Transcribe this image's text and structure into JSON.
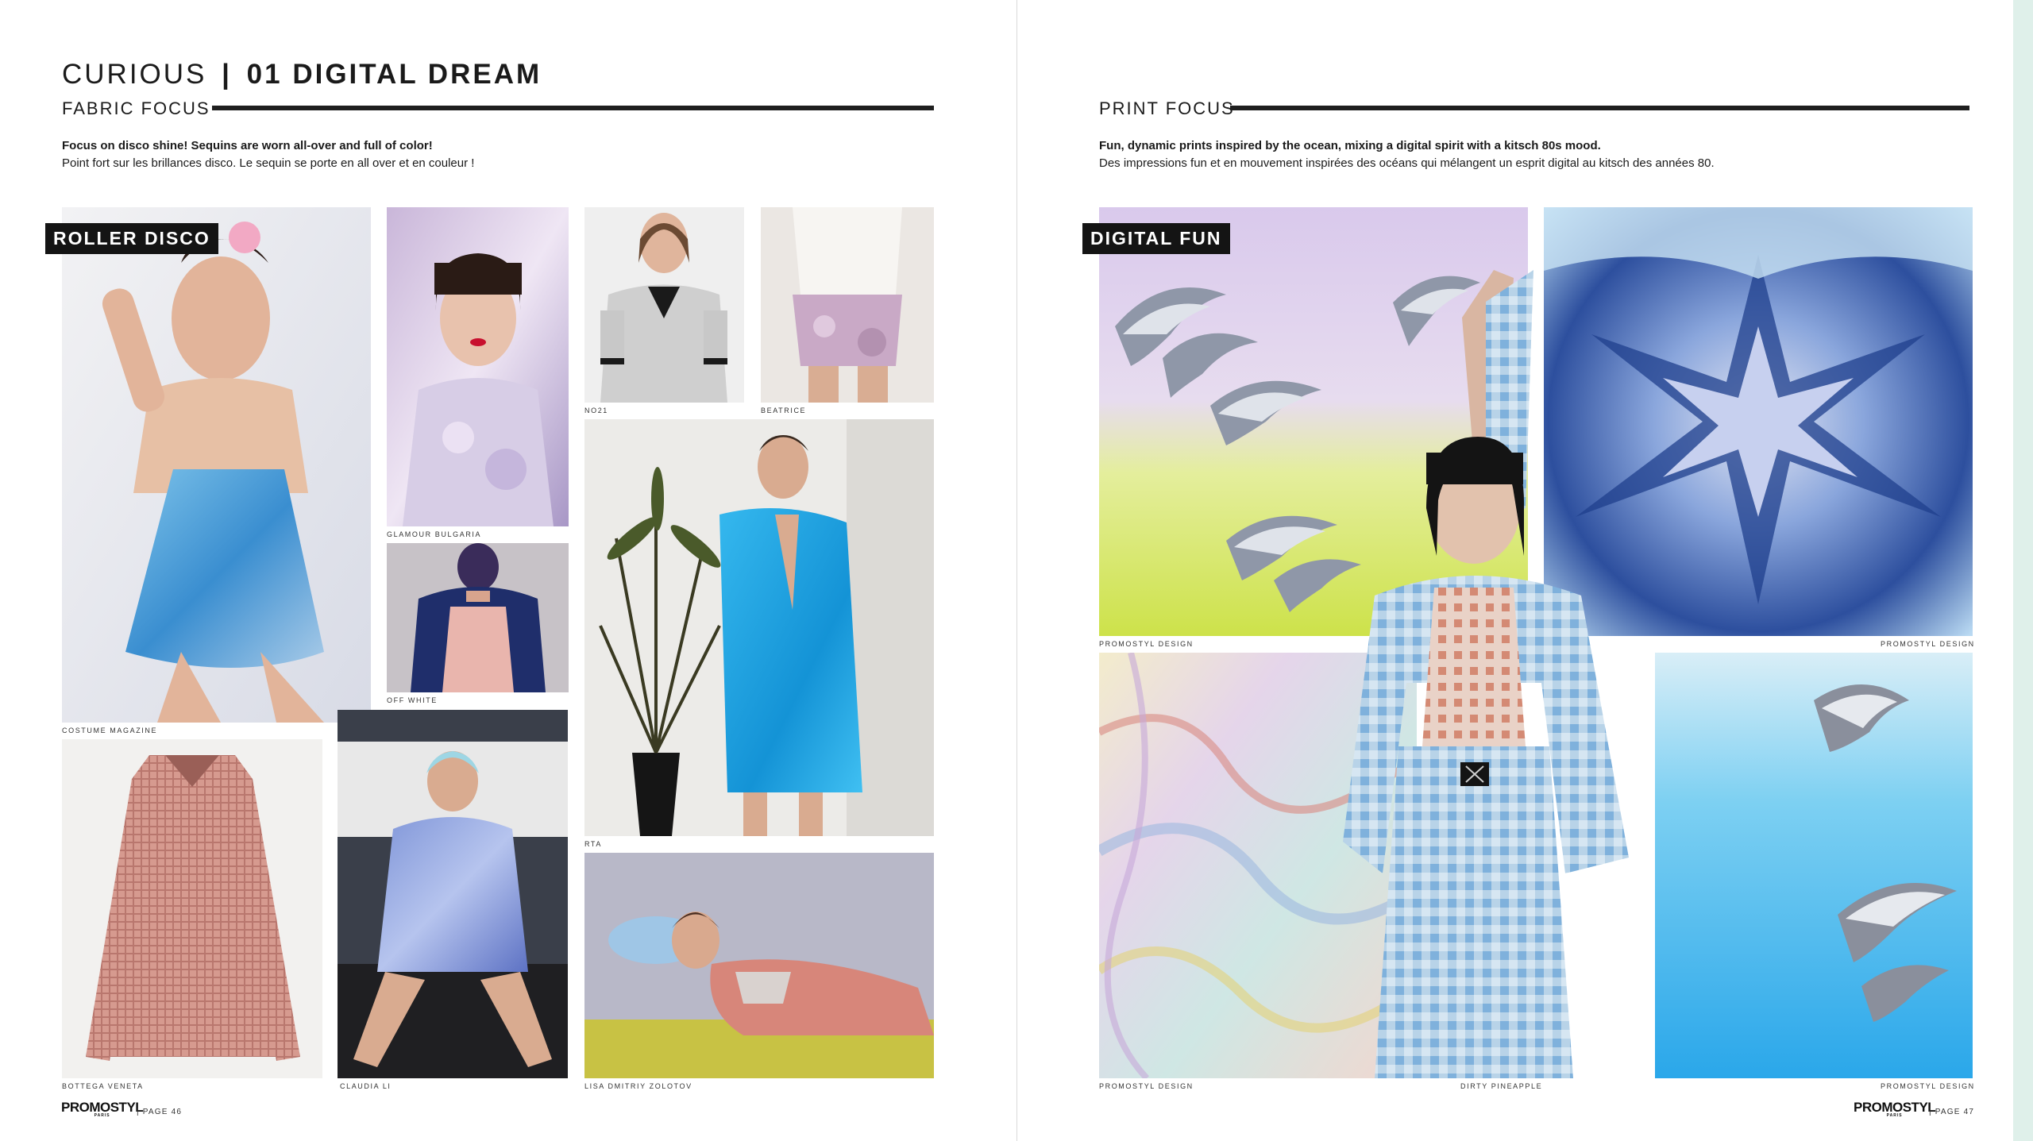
{
  "left_page": {
    "title": {
      "light": "CURIOUS",
      "sep": "|",
      "bold": "01 DIGITAL DREAM"
    },
    "section": "FABRIC FOCUS",
    "intro_en": "Focus on disco shine! Sequins are worn all-over and full of color!",
    "intro_fr": "Point fort sur les brillances disco. Le sequin se porte en all over et en couleur !",
    "tag": "ROLLER DISCO",
    "captions": {
      "costume": "COSTUME MAGAZINE",
      "glamour": "GLAMOUR BULGARIA",
      "offwhite": "OFF WHITE",
      "no21": "NO21",
      "beatrice": "BEATRICE",
      "rta": "RTA",
      "bottega": "BOTTEGA VENETA",
      "claudia": "CLAUDIA LI",
      "lisa": "LISA DMITRIY ZOLOTOV"
    },
    "footer_logo": "PROMOSTYL",
    "footer_logo_sub": "PARIS",
    "footer_page": "|   PAGE 46"
  },
  "right_page": {
    "section": "PRINT FOCUS",
    "intro_en": "Fun, dynamic prints inspired by the ocean, mixing a digital spirit with a kitsch 80s mood.",
    "intro_fr": "Des impressions fun et en mouvement inspirées des océans qui mélangent un esprit digital au kitsch des années 80.",
    "tag": "DIGITAL FUN",
    "captions": {
      "tl": "PROMOSTYL DESIGN",
      "tr": "PROMOSTYL DESIGN",
      "bl": "PROMOSTYL DESIGN",
      "bc": "DIRTY PINEAPPLE",
      "br": "PROMOSTYL DESIGN"
    },
    "footer_logo": "PROMOSTYL",
    "footer_logo_sub": "PARIS",
    "footer_page": "|   PAGE 47"
  },
  "colors": {
    "rule": "#1f1f1f",
    "tag_bg": "#141414",
    "edge_strip": "#dff0ea"
  }
}
